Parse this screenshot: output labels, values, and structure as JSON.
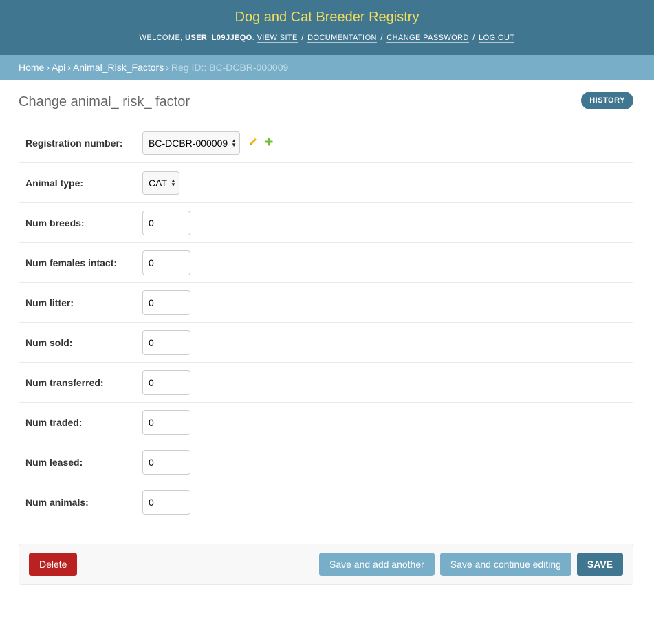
{
  "header": {
    "site_name": "Dog and Cat Breeder Registry",
    "welcome": "Welcome,",
    "username": "USER_L09JJEQO",
    "links": {
      "view_site": "View site",
      "documentation": "Documentation",
      "change_password": "Change password",
      "log_out": "Log out"
    }
  },
  "breadcrumbs": {
    "home": "Home",
    "api": "Api",
    "model": "Animal_Risk_Factors",
    "current": "Reg ID:: BC-DCBR-000009"
  },
  "page": {
    "title": "Change animal_ risk_ factor",
    "history": "History"
  },
  "form": {
    "registration_number": {
      "label": "Registration number:",
      "value": "BC-DCBR-000009"
    },
    "animal_type": {
      "label": "Animal type:",
      "value": "CAT"
    },
    "num_breeds": {
      "label": "Num breeds:",
      "value": "0"
    },
    "num_females_intact": {
      "label": "Num females intact:",
      "value": "0"
    },
    "num_litter": {
      "label": "Num litter:",
      "value": "0"
    },
    "num_sold": {
      "label": "Num sold:",
      "value": "0"
    },
    "num_transferred": {
      "label": "Num transferred:",
      "value": "0"
    },
    "num_traded": {
      "label": "Num traded:",
      "value": "0"
    },
    "num_leased": {
      "label": "Num leased:",
      "value": "0"
    },
    "num_animals": {
      "label": "Num animals:",
      "value": "0"
    }
  },
  "buttons": {
    "delete": "Delete",
    "save_add_another": "Save and add another",
    "save_continue": "Save and continue editing",
    "save": "Save"
  },
  "colors": {
    "header_bg": "#417690",
    "site_name": "#f5dd5d",
    "breadcrumb_bg": "#79aec8",
    "delete": "#ba2121",
    "edit_icon": "#efb80b",
    "add_icon": "#70bf2b"
  },
  "icons": {
    "edit": "pencil-icon",
    "add": "plus-icon",
    "select": "select-arrows-icon"
  }
}
